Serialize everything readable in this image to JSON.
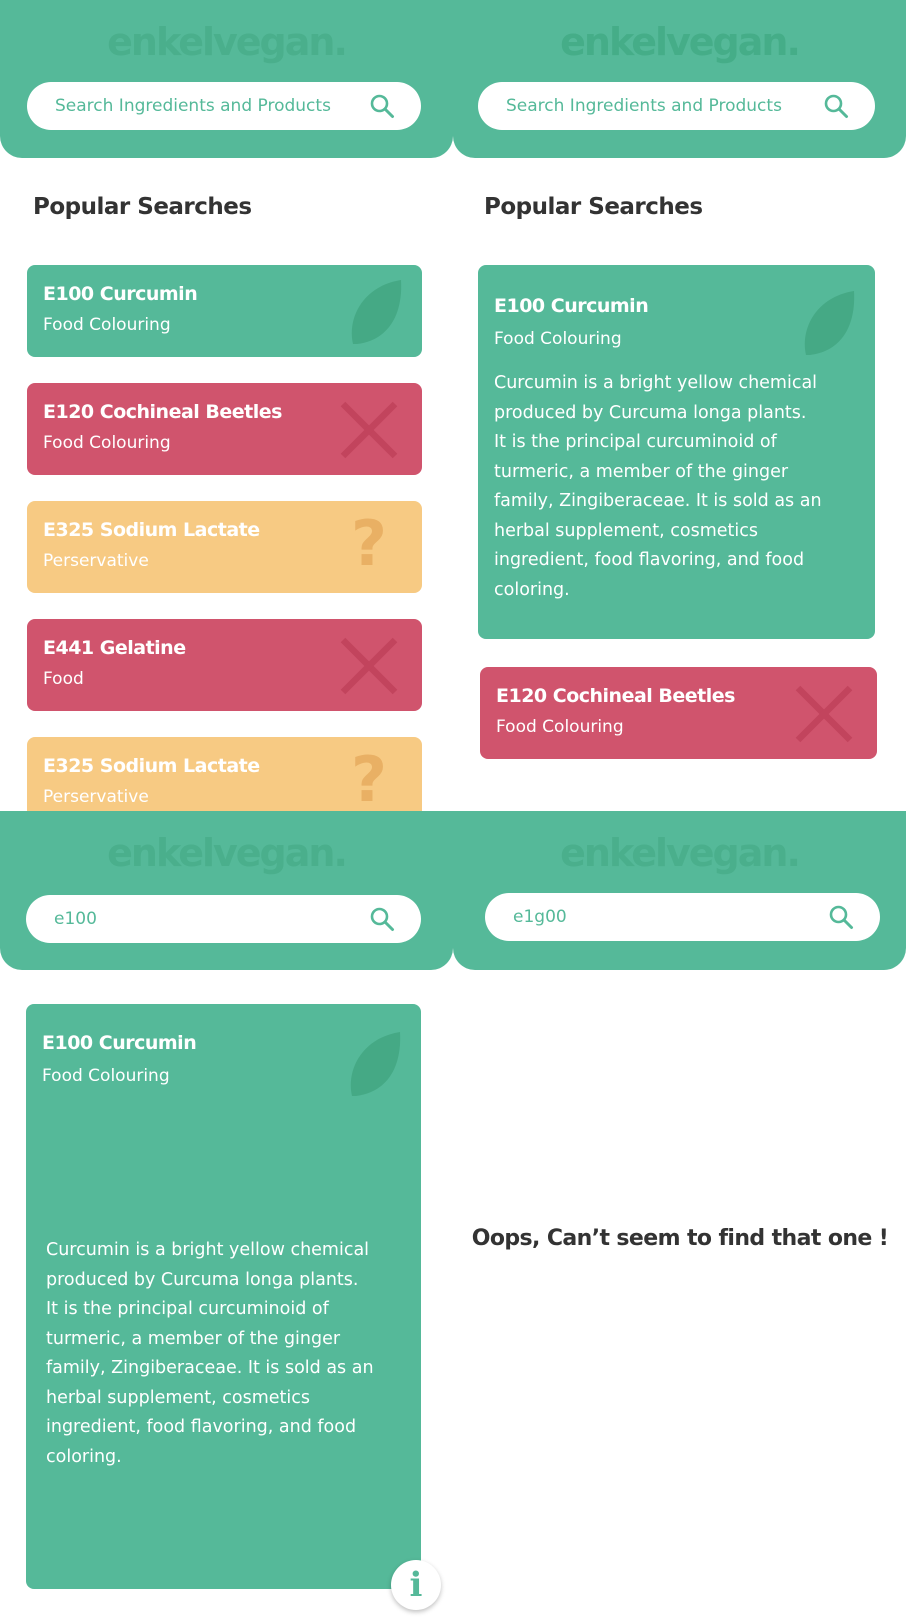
{
  "brand": {
    "logo": "enkelvegan.",
    "accent": "#55b999",
    "red": "#d0546d",
    "yellow": "#f7ca83"
  },
  "screen1": {
    "search": {
      "placeholder": "Search Ingredients and Products",
      "icon": "search-icon"
    },
    "title": "Popular Searches",
    "cards": [
      {
        "name": "E100 Curcumin",
        "category": "Food Colouring",
        "status": "vegan",
        "icon": "leaf-icon"
      },
      {
        "name": "E120 Cochineal Beetles",
        "category": "Food Colouring",
        "status": "not-vegan",
        "icon": "cross-icon"
      },
      {
        "name": "E325 Sodium Lactate",
        "category": "Perservative",
        "status": "unknown",
        "icon": "question-icon"
      },
      {
        "name": "E441 Gelatine",
        "category": "Food",
        "status": "not-vegan",
        "icon": "cross-icon"
      },
      {
        "name": "E325 Sodium Lactate",
        "category": "Perservative",
        "status": "unknown",
        "icon": "question-icon"
      }
    ]
  },
  "screen2": {
    "search": {
      "placeholder": "Search Ingredients and Products",
      "icon": "search-icon"
    },
    "title": "Popular Searches",
    "expanded_card": {
      "name": "E100 Curcumin",
      "category": "Food Colouring",
      "description": "Curcumin is a bright yellow chemical produced by Curcuma longa plants. It is the principal curcuminoid of turmeric, a member of the ginger family, Zingiberaceae. It is sold as an herbal supplement, cosmetics ingredient, food flavoring, and food coloring."
    },
    "card": {
      "name": "E120 Cochineal Beetles",
      "category": "Food Colouring"
    }
  },
  "screen3": {
    "search": {
      "value": "e100",
      "icon": "search-icon"
    },
    "detail": {
      "name": "E100 Curcumin",
      "category": "Food Colouring",
      "description": "Curcumin is a bright yellow chemical produced by Curcuma longa plants. It is the principal curcuminoid of turmeric, a member of the ginger family, Zingiberaceae. It is sold as an herbal supplement, cosmetics ingredient, food flavoring, and food coloring.",
      "info": "i"
    }
  },
  "screen4": {
    "search": {
      "value": "e1g00",
      "icon": "search-icon"
    },
    "message": "Oops, Can’t seem to find that one !"
  }
}
